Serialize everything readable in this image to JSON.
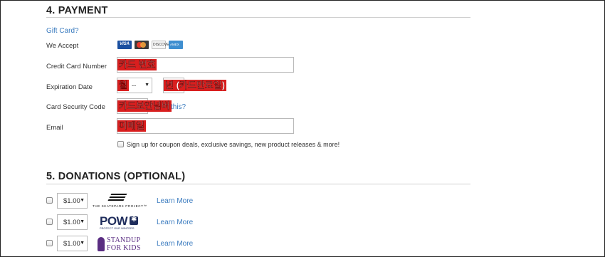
{
  "payment": {
    "title": "4. PAYMENT",
    "gift_card_link": "Gift Card?",
    "we_accept_label": "We Accept",
    "cards": [
      {
        "name": "VISA",
        "color": "#1a4fa0"
      },
      {
        "name": "MasterCard",
        "color": "#e8a23a"
      },
      {
        "name": "DISCOVER",
        "color": "#f2f2f2"
      },
      {
        "name": "AMERICAN EXPRESS",
        "color": "#3f8fd0"
      }
    ],
    "credit_card_label": "Credit Card Number",
    "credit_card_overlay": "카드 번호",
    "expiration_label": "Expiration Date",
    "month_select_value": "--",
    "month_overlay": "월",
    "year_overlay": "년 (카드만료일)",
    "security_label": "Card Security Code",
    "security_overlay": "카드보안넘버",
    "security_help_link": "this?",
    "email_label": "Email",
    "email_overlay": "이메일",
    "signup_text": "Sign up for coupon deals, exclusive savings, new product releases & more!"
  },
  "donations": {
    "title": "5. DONATIONS (OPTIONAL)",
    "items": [
      {
        "amount": "$1.00",
        "logo_text": "THE SKATEPARK PROJECT™",
        "learn_more": "Learn More"
      },
      {
        "amount": "$1.00",
        "logo_text": "POW",
        "logo_sub": "PROTECT OUR WINTERS",
        "learn_more": "Learn More"
      },
      {
        "amount": "$1.00",
        "logo_text": "STANDUP",
        "logo_sub": "FOR KIDS",
        "learn_more": "Learn More"
      }
    ]
  },
  "colors": {
    "overlay_red": "#d91e1e",
    "link_blue": "#3a7bbf",
    "pow_navy": "#1f2d5c",
    "standup_purple": "#5a2d82"
  }
}
